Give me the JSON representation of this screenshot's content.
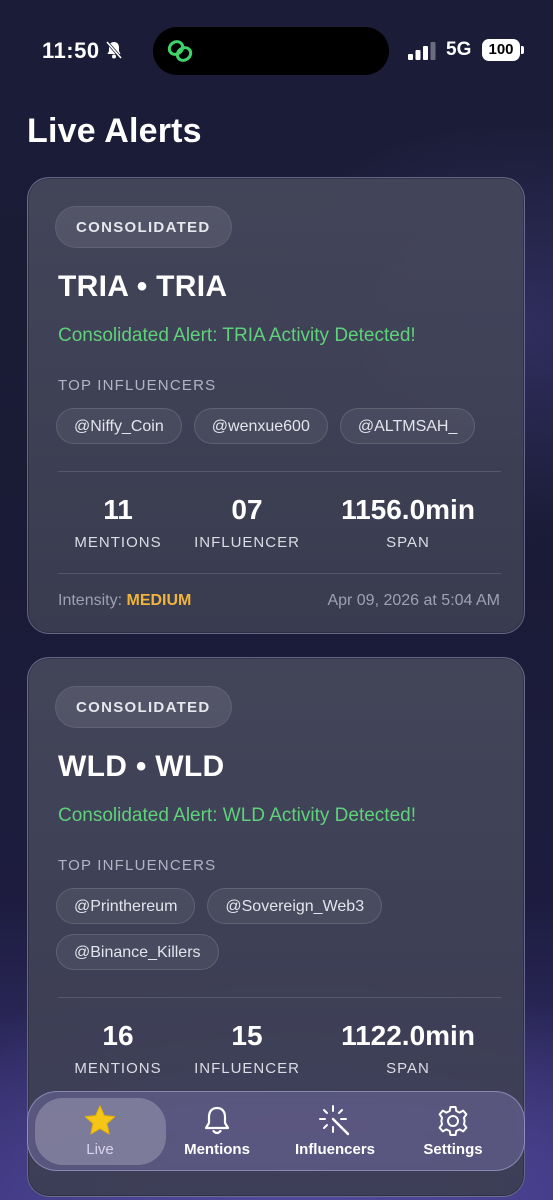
{
  "status_bar": {
    "time": "11:50",
    "network": "5G",
    "battery": "100"
  },
  "page": {
    "title": "Live Alerts"
  },
  "alerts": [
    {
      "badge": "CONSOLIDATED",
      "symbol": "TRIA • TRIA",
      "message": "Consolidated Alert: TRIA Activity Detected!",
      "influencers_label": "TOP INFLUENCERS",
      "influencers": [
        "@Niffy_Coin",
        "@wenxue600",
        "@ALTMSAH_"
      ],
      "mentions_value": "11",
      "mentions_label": "MENTIONS",
      "influencer_value": "07",
      "influencer_label": "INFLUENCER",
      "span_value": "1156.0min",
      "span_label": "SPAN",
      "intensity_label": "Intensity:",
      "intensity_value": "MEDIUM",
      "timestamp": "Apr 09, 2026 at 5:04 AM"
    },
    {
      "badge": "CONSOLIDATED",
      "symbol": "WLD • WLD",
      "message": "Consolidated Alert: WLD Activity Detected!",
      "influencers_label": "TOP INFLUENCERS",
      "influencers": [
        "@Printhereum",
        "@Sovereign_Web3",
        "@Binance_Killers"
      ],
      "mentions_value": "16",
      "mentions_label": "MENTIONS",
      "influencer_value": "15",
      "influencer_label": "INFLUENCER",
      "span_value": "1122.0min",
      "span_label": "SPAN"
    }
  ],
  "tabs": [
    {
      "label": "Live",
      "icon": "star-icon",
      "active": true
    },
    {
      "label": "Mentions",
      "icon": "bell-icon"
    },
    {
      "label": "Influencers",
      "icon": "sparkle-wand-icon"
    },
    {
      "label": "Settings",
      "icon": "gear-icon"
    }
  ],
  "colors": {
    "accent_green": "#5fd17b",
    "intensity_orange": "#f0b43a",
    "star_yellow": "#f5c518"
  }
}
